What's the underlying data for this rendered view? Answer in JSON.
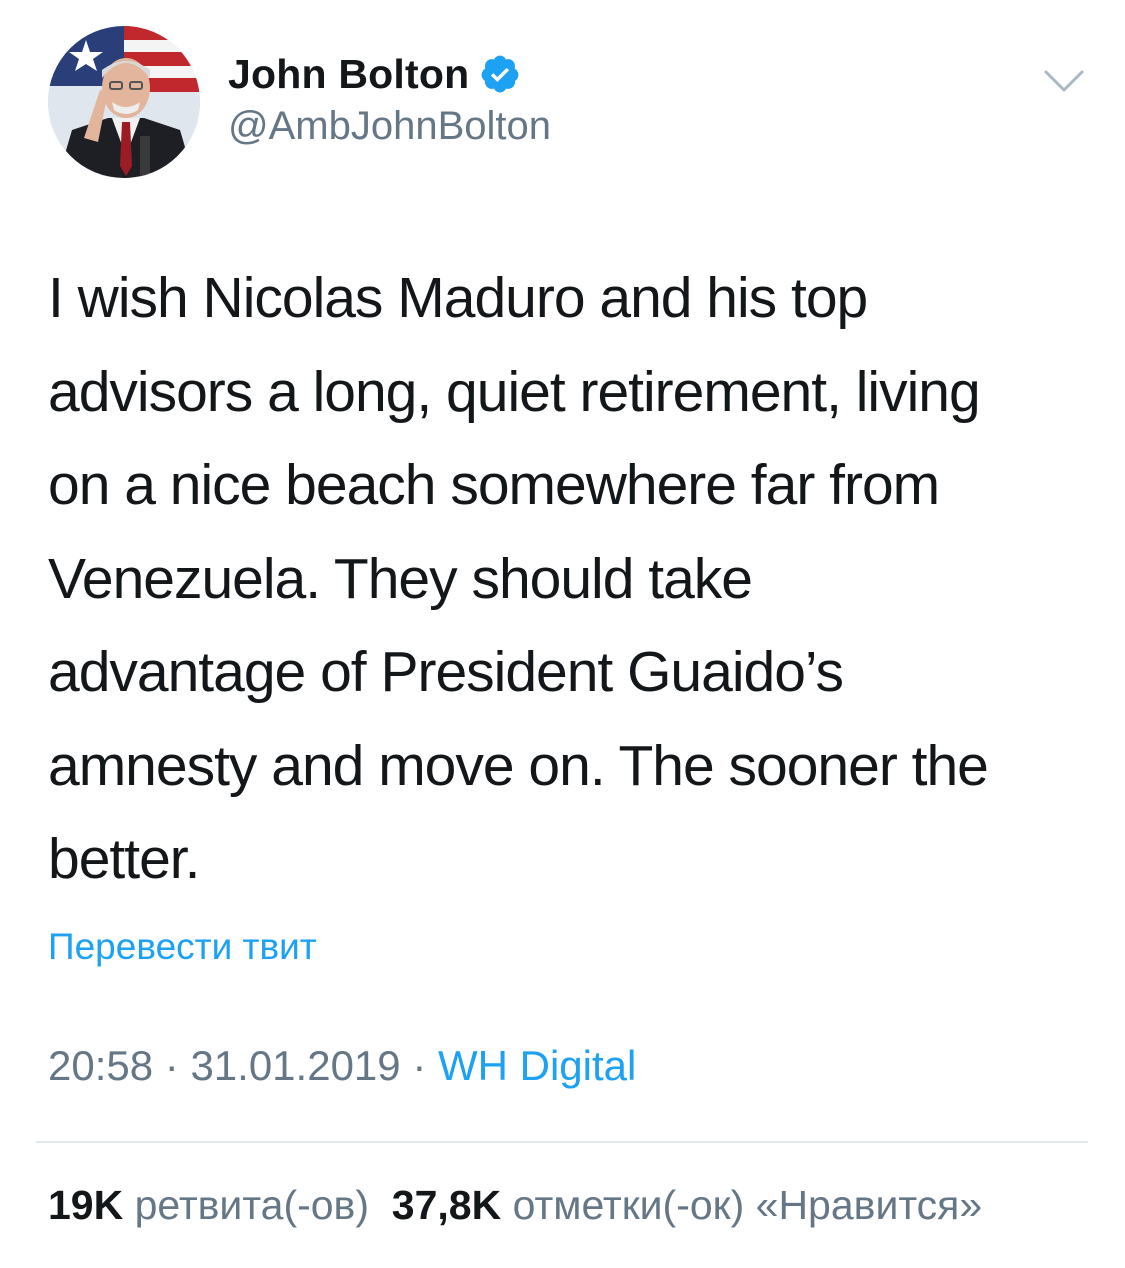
{
  "author": {
    "display_name": "John Bolton",
    "handle": "@AmbJohnBolton",
    "verified_icon": "verified-badge-icon",
    "avatar_icon": "avatar-photo"
  },
  "menu": {
    "icon": "chevron-down-icon"
  },
  "tweet": {
    "lines": [
      "I wish Nicolas Maduro and his top",
      "advisors a long, quiet retirement, living",
      "on a nice beach somewhere far from",
      "Venezuela. They should take",
      "advantage of President Guaido’s",
      "amnesty and move on. The sooner the",
      "better."
    ],
    "translate_label": "Перевести твит"
  },
  "meta": {
    "time": "20:58",
    "date": "31.01.2019",
    "separator": " · ",
    "source": "WH Digital"
  },
  "stats": {
    "retweets_count": "19K",
    "retweets_label": "ретвита(-ов)",
    "likes_count": "37,8K",
    "likes_label": "отметки(-ок) «Нравится»"
  },
  "colors": {
    "text": "#14171a",
    "secondary": "#657786",
    "link": "#1da1f2",
    "divider": "#e1e8ed"
  }
}
